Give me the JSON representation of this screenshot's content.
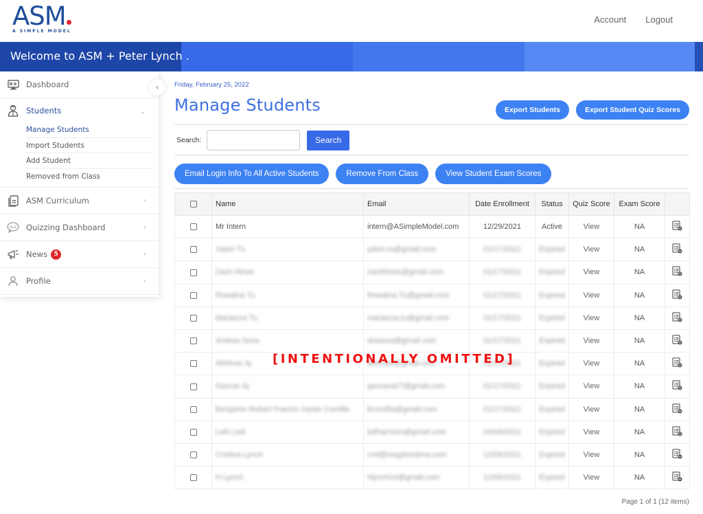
{
  "header": {
    "logo": {
      "text": "ASM",
      "tagline": "A SIMPLE MODEL",
      "dot_color": "#e0262b"
    },
    "links": [
      "Account",
      "Logout"
    ]
  },
  "banner": {
    "welcome": "Welcome to ASM + Peter Lynch ."
  },
  "sidebar": {
    "items": [
      {
        "label": "Dashboard",
        "icon": "dashboard-monitor-icon"
      },
      {
        "label": "Students",
        "icon": "student-icon",
        "expanded": true,
        "children": [
          {
            "label": "Manage Students",
            "active": true
          },
          {
            "label": "Import Students"
          },
          {
            "label": "Add Student"
          },
          {
            "label": "Removed from Class"
          }
        ]
      },
      {
        "label": "ASM Curriculum",
        "icon": "document-icon"
      },
      {
        "label": "Quizzing Dashboard",
        "icon": "quiz-bubble-icon"
      },
      {
        "label": "News",
        "icon": "megaphone-icon",
        "badge": "5"
      },
      {
        "label": "Profile",
        "icon": "user-icon"
      }
    ]
  },
  "main": {
    "date": "Friday, February 25, 2022",
    "title": "Manage Students",
    "export_buttons": [
      "Export Students",
      "Export Student Quiz Scores"
    ],
    "search": {
      "label": "Search:",
      "value": "",
      "placeholder": "",
      "button": "Search"
    },
    "actions": [
      "Email Login Info To All Active Students",
      "Remove From Class",
      "View Student Exam Scores"
    ],
    "table": {
      "columns": [
        "",
        "Name",
        "Email",
        "Date Enrollment",
        "Status",
        "Quiz Score",
        "Exam Score",
        ""
      ],
      "rows": [
        {
          "name": "Mr Intern",
          "email": "intern@ASimpleModel.com",
          "date": "12/29/2021",
          "status": "Active",
          "quiz": "View",
          "exam": "NA",
          "blurred": false
        },
        {
          "name": "Yaton Tu",
          "email": "yaton.tu@gmail.com",
          "date": "01/17/2021",
          "status": "Expired",
          "quiz": "View",
          "exam": "NA",
          "blurred": true
        },
        {
          "name": "Zach Hines",
          "email": "zachhines@gmail.com",
          "date": "01/17/2021",
          "status": "Expired",
          "quiz": "View",
          "exam": "NA",
          "blurred": true
        },
        {
          "name": "Rosalina Tu",
          "email": "Rosalina.Tu@gmail.com",
          "date": "01/17/2021",
          "status": "Expired",
          "quiz": "View",
          "exam": "NA",
          "blurred": true
        },
        {
          "name": "Marianna Tu",
          "email": "marianna.tu@gmail.com",
          "date": "01/17/2021",
          "status": "Expired",
          "quiz": "View",
          "exam": "NA",
          "blurred": true
        },
        {
          "name": "Andrea Sesa",
          "email": "dresesa@gmail.com",
          "date": "01/17/2021",
          "status": "Expired",
          "quiz": "View",
          "exam": "NA",
          "blurred": true
        },
        {
          "name": "Abhinav Aj",
          "email": "abhinav@gmail.com",
          "date": "01/17/2021",
          "status": "Expired",
          "quiz": "View",
          "exam": "NA",
          "blurred": true
        },
        {
          "name": "Gaurav Aj",
          "email": "gaurava27@gmail.com",
          "date": "01/17/2021",
          "status": "Expired",
          "quiz": "View",
          "exam": "NA",
          "blurred": true
        },
        {
          "name": "Benjamin Robert Francis Xavier Comfils",
          "email": "bcomfils@gmail.com",
          "date": "01/17/2021",
          "status": "Expired",
          "quiz": "View",
          "exam": "NA",
          "blurred": true
        },
        {
          "name": "Leili Lodi",
          "email": "leilharrison@gmail.com",
          "date": "04/06/2021",
          "status": "Expired",
          "quiz": "View",
          "exam": "NA",
          "blurred": true
        },
        {
          "name": "Cristina Lynch",
          "email": "cml@magdondima.com",
          "date": "12/06/2021",
          "status": "Expired",
          "quiz": "View",
          "exam": "NA",
          "blurred": true
        },
        {
          "name": "H Lynch",
          "email": "hlynch10@gmail.com",
          "date": "12/06/2021",
          "status": "Expired",
          "quiz": "View",
          "exam": "NA",
          "blurred": true
        }
      ],
      "row_action_icon": "report-settings-icon"
    },
    "pager": "Page 1 of 1 (12 items)"
  },
  "overlay": {
    "redaction_label": "[INTENTIONALLY OMITTED]"
  },
  "colors": {
    "primary": "#3d82f3",
    "banner_dark": "#1e46a8",
    "title": "#3d6fe0",
    "badge": "#e0262b"
  }
}
